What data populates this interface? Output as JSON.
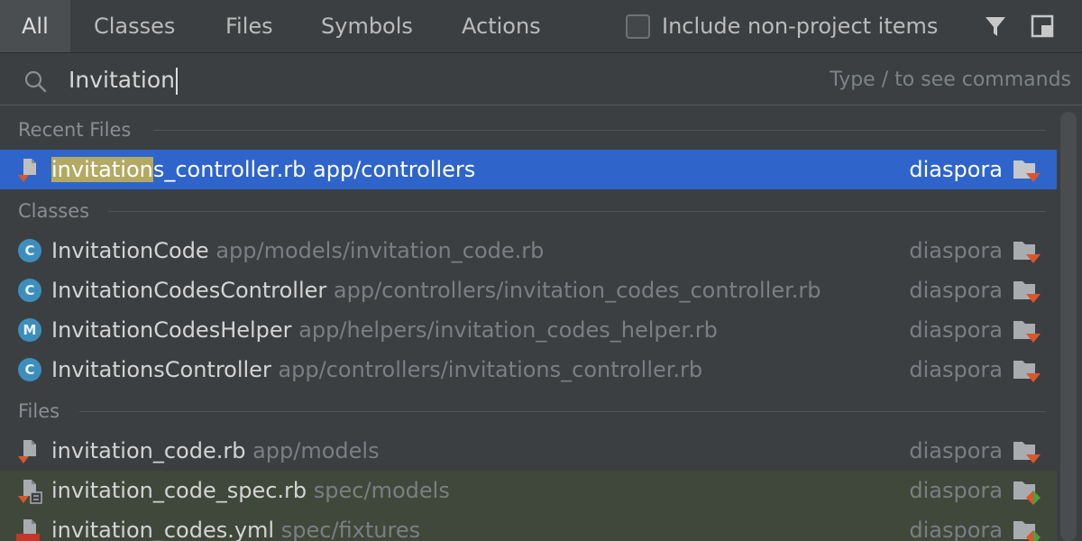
{
  "tabs": [
    {
      "label": "All",
      "active": true
    },
    {
      "label": "Classes"
    },
    {
      "label": "Files"
    },
    {
      "label": "Symbols"
    },
    {
      "label": "Actions"
    }
  ],
  "include_non_project": {
    "label": "Include non-project items",
    "checked": false
  },
  "search": {
    "value": "Invitation",
    "hint": "Type / to see commands"
  },
  "sections": {
    "recent": "Recent Files",
    "classes": "Classes",
    "files": "Files"
  },
  "recent_files": [
    {
      "highlight": "invitation",
      "rest": "s_controller.rb",
      "path": "app/controllers",
      "project": "diaspora",
      "icon": "ruby-file-icon"
    }
  ],
  "classes": [
    {
      "badge": "C",
      "name": "InvitationCode",
      "path": "app/models/invitation_code.rb",
      "project": "diaspora",
      "icon": "class-icon"
    },
    {
      "badge": "C",
      "name": "InvitationCodesController",
      "path": "app/controllers/invitation_codes_controller.rb",
      "project": "diaspora",
      "icon": "class-icon"
    },
    {
      "badge": "M",
      "name": "InvitationCodesHelper",
      "path": "app/helpers/invitation_codes_helper.rb",
      "project": "diaspora",
      "icon": "module-icon"
    },
    {
      "badge": "C",
      "name": "InvitationsController",
      "path": "app/controllers/invitations_controller.rb",
      "project": "diaspora",
      "icon": "class-icon"
    }
  ],
  "files": [
    {
      "name": "invitation_code.rb",
      "path": "app/models",
      "project": "diaspora",
      "icon": "ruby-file-icon"
    },
    {
      "name": "invitation_code_spec.rb",
      "path": "spec/models",
      "project": "diaspora",
      "icon": "ruby-spec-file-icon"
    },
    {
      "name": "invitation_codes.yml",
      "path": "spec/fixtures",
      "project": "diaspora",
      "icon": "yml-file-icon"
    }
  ],
  "colors": {
    "selection": "#2f65ca",
    "highlight": "#b3a962",
    "test_row": "#40483b",
    "class_badge": "#3c8fbd"
  }
}
